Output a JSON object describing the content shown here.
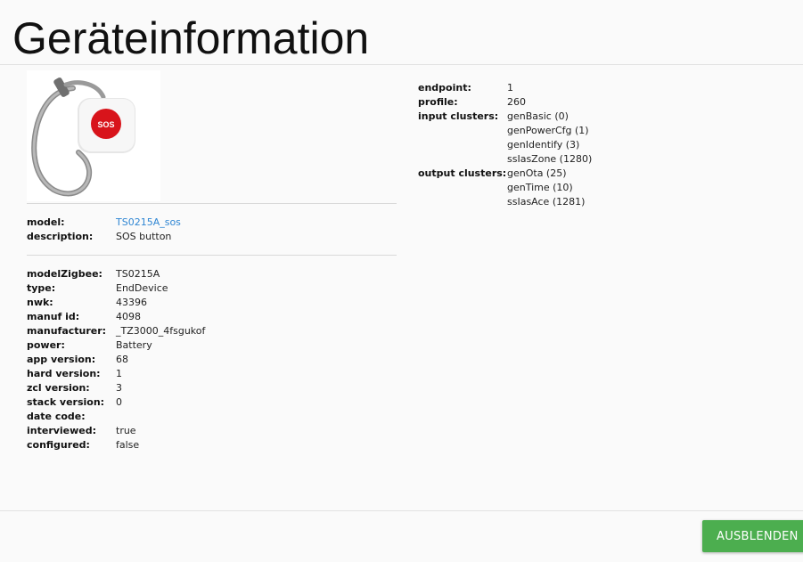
{
  "header": {
    "title": "Geräteinformation"
  },
  "device_image": {
    "badge_text": "SOS"
  },
  "model_section": {
    "rows": [
      {
        "label": "model:",
        "value": "TS0215A_sos"
      },
      {
        "label": "description:",
        "value": "SOS button"
      }
    ]
  },
  "details": {
    "rows": [
      {
        "label": "modelZigbee:",
        "value": "TS0215A"
      },
      {
        "label": "type:",
        "value": "EndDevice"
      },
      {
        "label": "nwk:",
        "value": "43396"
      },
      {
        "label": "manuf id:",
        "value": "4098"
      },
      {
        "label": "manufacturer:",
        "value": "_TZ3000_4fsgukof"
      },
      {
        "label": "power:",
        "value": "Battery"
      },
      {
        "label": "app version:",
        "value": "68"
      },
      {
        "label": "hard version:",
        "value": "1"
      },
      {
        "label": "zcl version:",
        "value": "3"
      },
      {
        "label": "stack version:",
        "value": "0"
      },
      {
        "label": "date code:",
        "value": ""
      },
      {
        "label": "interviewed:",
        "value": "true"
      },
      {
        "label": "configured:",
        "value": "false"
      }
    ]
  },
  "endpoint": {
    "endpoint_label": "endpoint:",
    "endpoint_value": "1",
    "profile_label": "profile:",
    "profile_value": "260",
    "input_label": "input clusters:",
    "input_clusters": [
      "genBasic (0)",
      "genPowerCfg (1)",
      "genIdentify (3)",
      "ssIasZone (1280)"
    ],
    "output_label": "output clusters:",
    "output_clusters": [
      "genOta (25)",
      "genTime (10)",
      "ssIasAce (1281)"
    ]
  },
  "footer": {
    "hide_button": "AUSBLENDEN"
  }
}
